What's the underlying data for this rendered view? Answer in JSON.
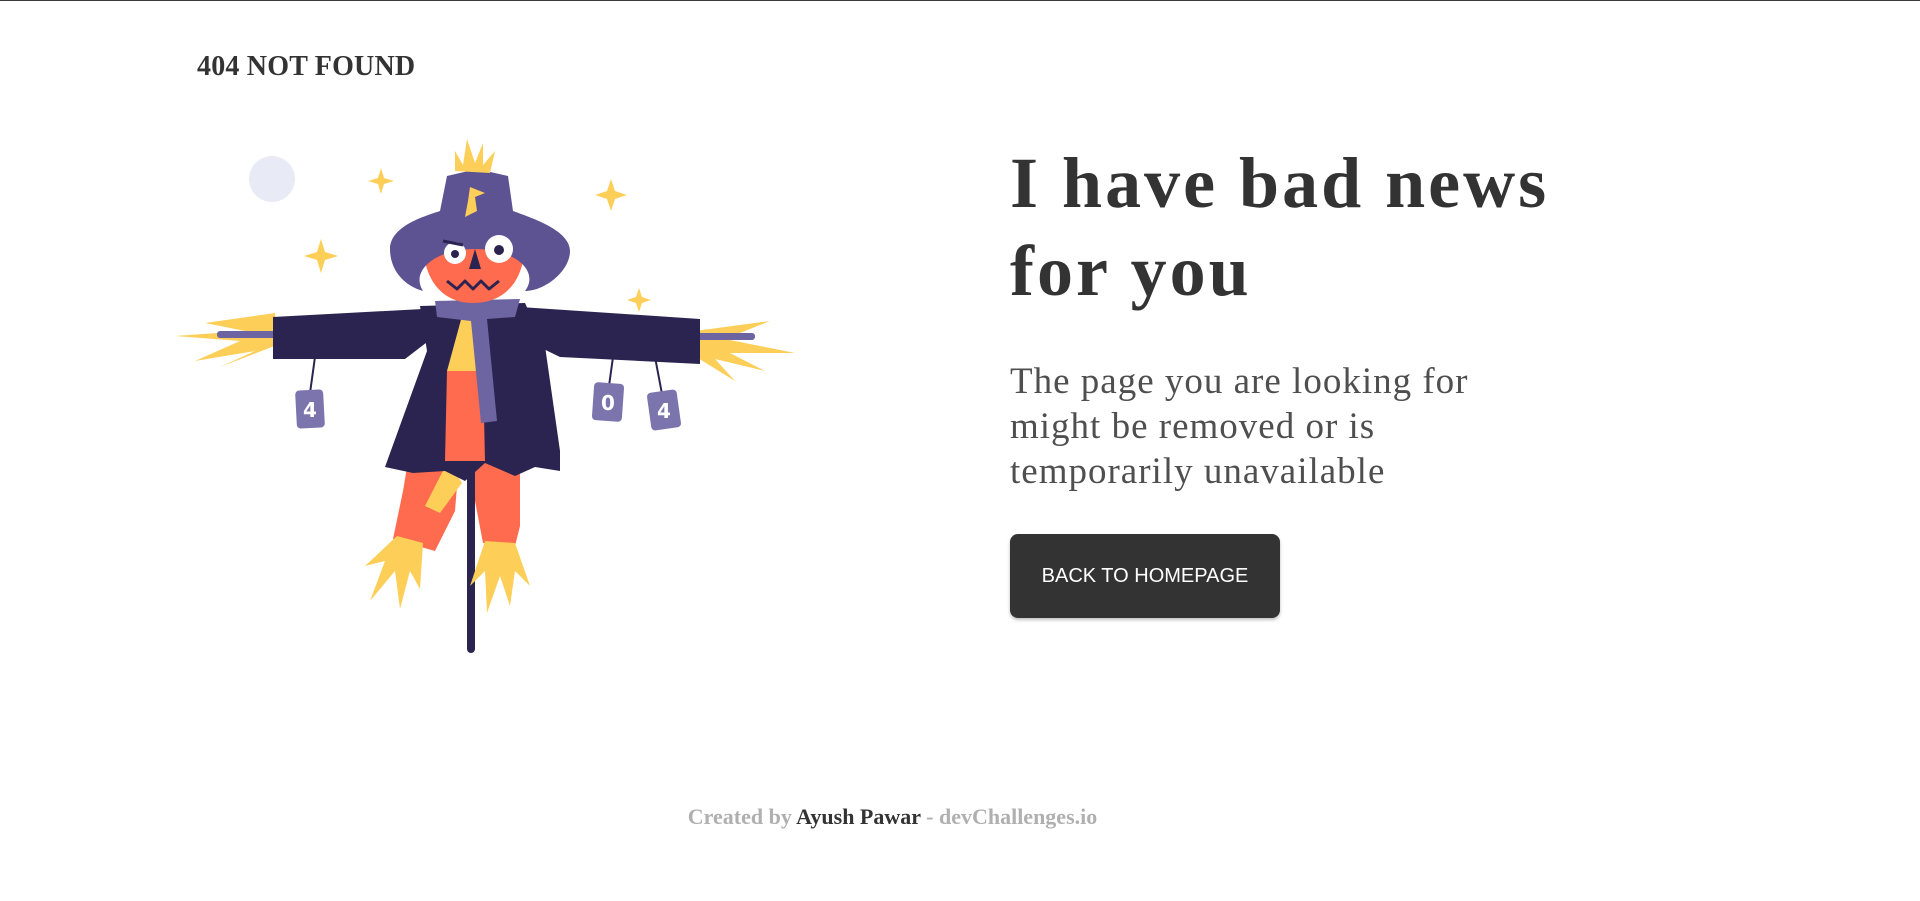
{
  "header": {
    "brand": "404 NOT FOUND"
  },
  "main": {
    "headline_line1": "I have bad news",
    "headline_line2": "for you",
    "subtext_line1": "The page you are looking for",
    "subtext_line2": "might be removed or is",
    "subtext_line3": "temporarily unavailable",
    "button_label": "BACK TO HOMEPAGE"
  },
  "illustration": {
    "can_labels": [
      "4",
      "0",
      "4"
    ],
    "colors": {
      "hat": "#5d5393",
      "coat": "#2b2450",
      "face": "#ff6b4f",
      "straw": "#fdcf58",
      "scarf": "#6d65a2",
      "moon": "#e8ebf5"
    }
  },
  "footer": {
    "created_by": "Created by",
    "author": "Ayush Pawar",
    "separator": "-",
    "site": "devChallenges.io"
  },
  "colors": {
    "text_dark": "#333333",
    "text_body": "#4f4f4f",
    "footer_muted": "#b0b0b0",
    "button_bg": "#333333"
  }
}
